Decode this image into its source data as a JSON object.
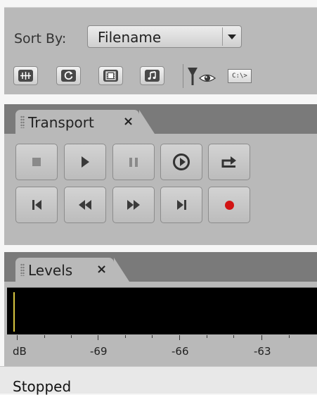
{
  "sort": {
    "label": "Sort By:",
    "value": "Filename"
  },
  "toolbar": {
    "icons": [
      "waveform-lanes-icon",
      "refresh-icon",
      "film-icon",
      "music-note-icon",
      "filter-eye-icon",
      "command-prompt-icon"
    ],
    "cmd_text": "C:\\>"
  },
  "transport": {
    "tab_label": "Transport",
    "close_glyph": "×",
    "record_color": "#d21414"
  },
  "levels": {
    "tab_label": "Levels",
    "close_glyph": "×",
    "scale_labels": [
      "dB",
      "-69",
      "-66",
      "-63"
    ]
  },
  "status": {
    "text": "Stopped"
  }
}
